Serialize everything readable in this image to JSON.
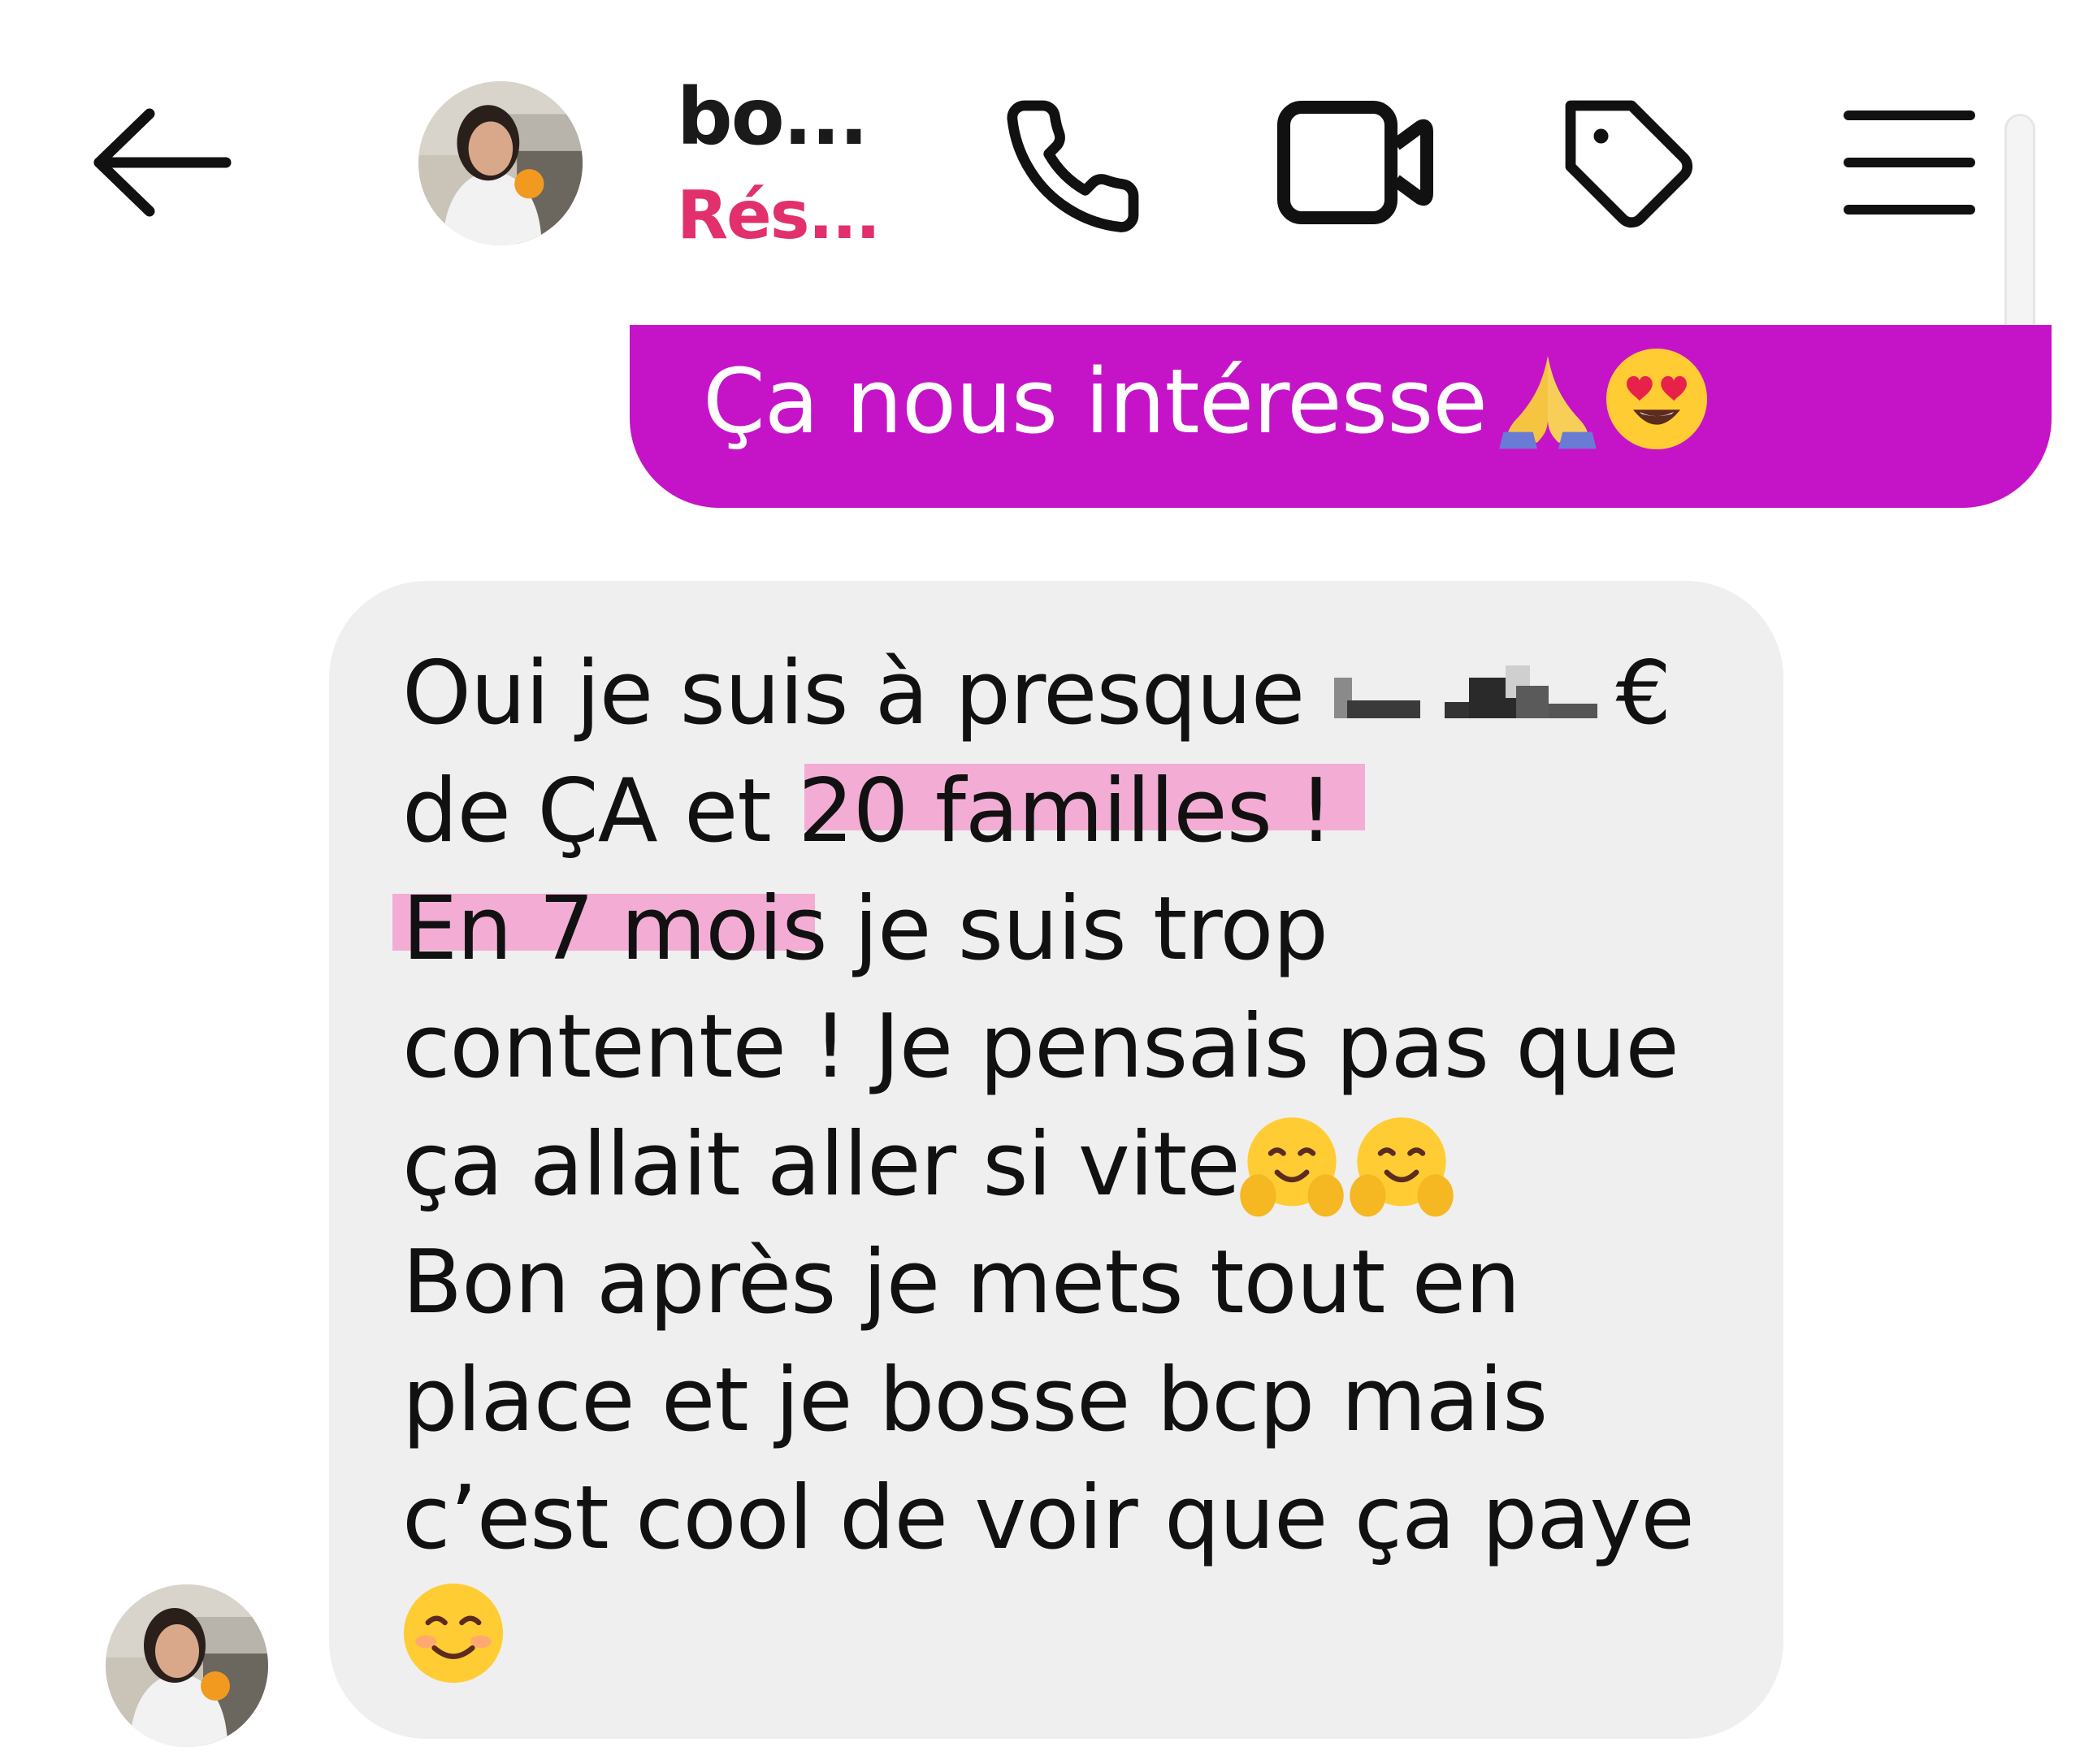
{
  "header": {
    "back_icon": "arrow-left-icon",
    "contact_name": "bo...",
    "contact_status": "Rés...",
    "status_color": "#e1306c",
    "actions": [
      {
        "name": "phone-icon"
      },
      {
        "name": "video-camera-icon"
      },
      {
        "name": "tag-icon"
      },
      {
        "name": "menu-icon"
      }
    ]
  },
  "conversation": {
    "outgoing": {
      "text": "Ça nous intéresse",
      "emojis": [
        "🙏",
        "😍"
      ],
      "bubble_color": "#c514c8"
    },
    "incoming": {
      "bubble_color": "#efefef",
      "lines": [
        {
          "before_redaction": "Oui je suis à presque ",
          "after_redaction": "€"
        },
        "de ÇA et 20 familles !",
        "En 7 mois je suis trop",
        "contente ! Je pensais pas que",
        "ça allait aller si vite",
        "Bon après je mets tout en",
        "place et je bosse bcp mais",
        "c’est cool de voir que ça paye"
      ],
      "highlighted": [
        "20 familles !",
        "En 7 mois"
      ],
      "highlight_color": "#f676be",
      "emojis": [
        "🤗",
        "🤗",
        "😊"
      ]
    }
  }
}
